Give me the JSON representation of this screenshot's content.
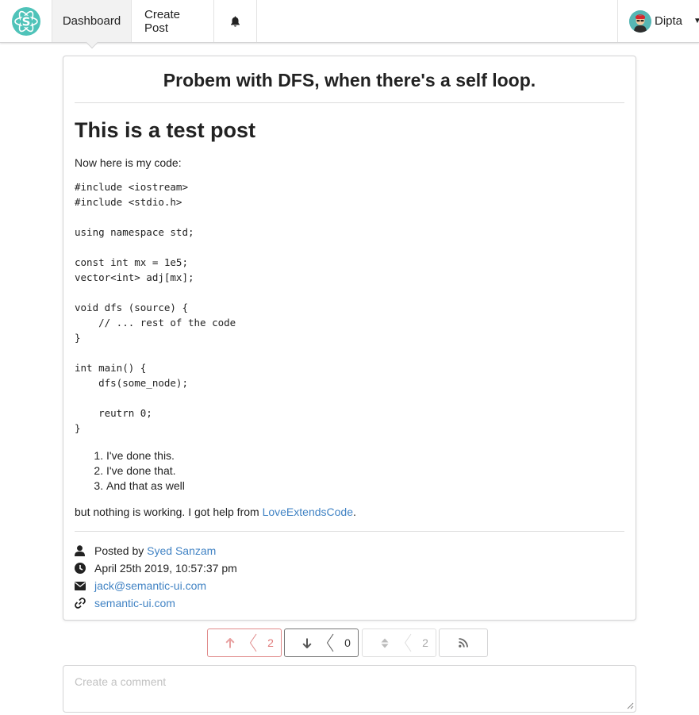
{
  "nav": {
    "logo_icon": "react-s-logo-icon",
    "items": [
      {
        "label": "Dashboard",
        "active": true
      },
      {
        "label": "Create Post",
        "active": false
      }
    ],
    "bell_icon": "bell-icon",
    "user": {
      "name": "Dipta",
      "avatar_icon": "user-avatar-icon",
      "caret_icon": "caret-down-icon"
    }
  },
  "post": {
    "title": "Probem with DFS, when there's a self loop.",
    "heading": "This is a test post",
    "intro": "Now here is my code:",
    "code": "#include <iostream>\n#include <stdio.h>\n\nusing namespace std;\n\nconst int mx = 1e5;\nvector<int> adj[mx];\n\nvoid dfs (source) {\n    // ... rest of the code\n}\n\nint main() {\n    dfs(some_node);\n\n    reutrn 0;\n}",
    "list": [
      "I've done this.",
      "I've done that.",
      "And that as well"
    ],
    "closing_text": "but nothing is working. I got help from ",
    "closing_link": "LoveExtendsCode",
    "closing_end": "."
  },
  "meta": {
    "posted_by_label": "Posted by ",
    "author": "Syed Sanzam",
    "date": "April 25th 2019, 10:57:37 pm",
    "email": "jack@semantic-ui.com",
    "website": "semantic-ui.com"
  },
  "votes": {
    "upvotes": "2",
    "downvotes": "0",
    "score": "2"
  },
  "comment": {
    "placeholder": "Create a comment"
  },
  "colors": {
    "link": "#4183c4",
    "upvote": "#e07a7a",
    "logo": "#4fc3b9"
  }
}
